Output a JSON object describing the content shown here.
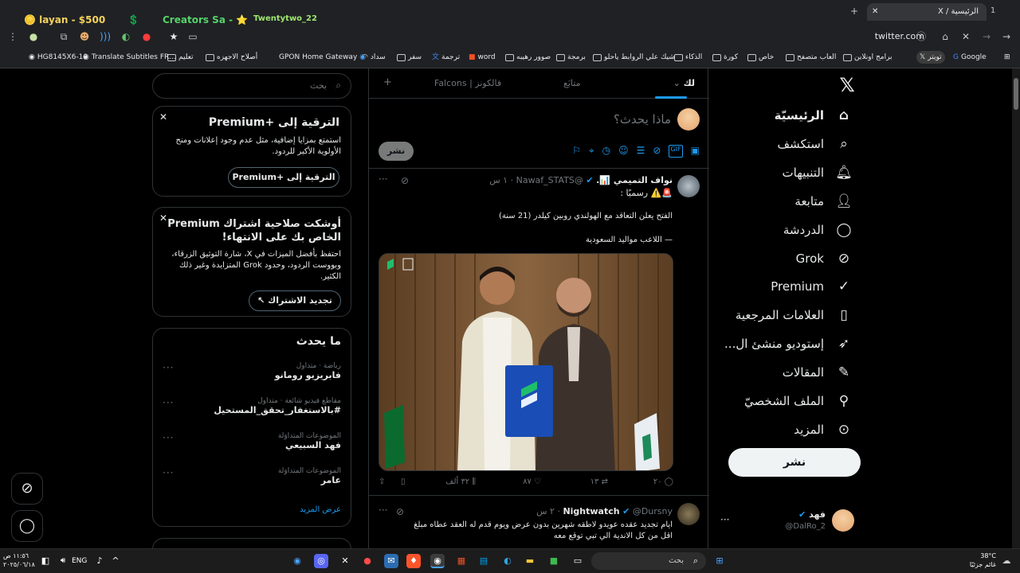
{
  "browser": {
    "tab_title": "الرئيسية / X",
    "tab_counter_left": "1",
    "new_tab": "+",
    "url": "twitter.com",
    "extension_chips": [
      {
        "label": "layan - $500"
      },
      {
        "label": "Creators Sa -"
      },
      {
        "label": "Twentytwo_22"
      }
    ],
    "bookmarks": [
      "Google",
      "تويتر",
      "برامج اونلاين",
      "العاب متصفح",
      "خاص",
      "كورة",
      "الذكاء",
      "شيك علي الروابط ياحلو",
      "برمجة",
      "صوور رهيبه",
      "word",
      "ترجمة",
      "سفر",
      "سداد",
      "GPON Home Gateway",
      "أصلاح الاجهزه",
      "تعليم",
      "Translate Subtitles FR...",
      "HG8145X6-10"
    ]
  },
  "sidebar": {
    "items": [
      {
        "label": "الرئيسيّة",
        "icon": "home-icon"
      },
      {
        "label": "استكشف",
        "icon": "search-icon"
      },
      {
        "label": "التنبيهات",
        "icon": "bell-icon"
      },
      {
        "label": "متابعة",
        "icon": "person-add-icon"
      },
      {
        "label": "الدردشة",
        "icon": "chat-icon"
      },
      {
        "label": "Grok",
        "icon": "grok-icon"
      },
      {
        "label": "Premium",
        "icon": "verified-icon"
      },
      {
        "label": "العلامات المرجعية",
        "icon": "bookmark-icon"
      },
      {
        "label": "إستوديو منشئ ال...",
        "icon": "rocket-icon"
      },
      {
        "label": "المقالات",
        "icon": "article-icon"
      },
      {
        "label": "الملف الشخصيّ",
        "icon": "profile-icon"
      },
      {
        "label": "المزيد",
        "icon": "more-icon"
      }
    ],
    "post_button": "نشر",
    "account": {
      "name": "فهد",
      "handle": "@DalRo_2"
    }
  },
  "feed": {
    "tabs": [
      "لك",
      "متابَع",
      "Falcons | فالكونز"
    ],
    "add_tab": "+",
    "composer": {
      "placeholder": "ماذا يحدث؟",
      "post_button": "نشر"
    },
    "tweets": [
      {
        "name": "نواف التميمي 📊.",
        "handle": "@Nawaf_STATS",
        "time": "١ س",
        "line1": "🚨⚠️ رسميًا :",
        "line2": "الفتح يعلن التعاقد مع الهولندي روبين كيلدر (21 سنة)",
        "line3": "— اللاعب مواليد السعودية",
        "stats": {
          "replies": "٢٠",
          "reposts": "١٣",
          "likes": "٨٧",
          "views": "٣٢ ألف"
        }
      },
      {
        "name": "Nightwatch",
        "handle": "@Dursny",
        "time": "٢ س",
        "text": "ايام تجديد عقده عويدو لاطقه شهرين بدون عرض ويوم قدم له العقد عطاه مبلغ اقل من كل الاندية الي تبي توقع معه"
      }
    ]
  },
  "right": {
    "search_placeholder": "بحث",
    "premium_card": {
      "title": "الترقية إلى +Premium",
      "body": "استمتع بمزايا إضافية، مثل عدم وجود إعلانات ومنح الأولوية الأكبر للردود.",
      "button": "الترقية إلى +Premium"
    },
    "expiry_card": {
      "title": "أوشكت صلاحية اشتراك Premium الخاص بك على الانتهاء!",
      "body": "احتفظ بأفضل الميزات في X، شارة التوثيق الزرقاء، وبووست الردود، وحدود Grok المتزايدة وغير ذلك الكثير.",
      "button": "تجديد الاشتراك"
    },
    "trends_card": {
      "title": "ما يحدث",
      "items": [
        {
          "meta": "رياضة · متداول",
          "name": "فابريزيو رومانو"
        },
        {
          "meta": "مقاطع فيديو شائعة · متداول",
          "name": "#بالاستغفار_تحقق_المستحيل"
        },
        {
          "meta": "الموضوعات المتداوَلة",
          "name": "فهد السبيعي"
        },
        {
          "meta": "الموضوعات المتداوَلة",
          "name": "عامر"
        }
      ],
      "show_more": "عرض المزيد"
    }
  },
  "taskbar": {
    "search_placeholder": "بحث",
    "weather_temp": "38°C",
    "weather_desc": "غائم جزئيًا",
    "lang": "ENG",
    "time": "١١:٥٦ ص",
    "date": "٢٠٢٥/٠٦/١٨"
  },
  "colors": {
    "accent": "#1d9bf0",
    "border": "#2f3336",
    "muted": "#71767b"
  }
}
